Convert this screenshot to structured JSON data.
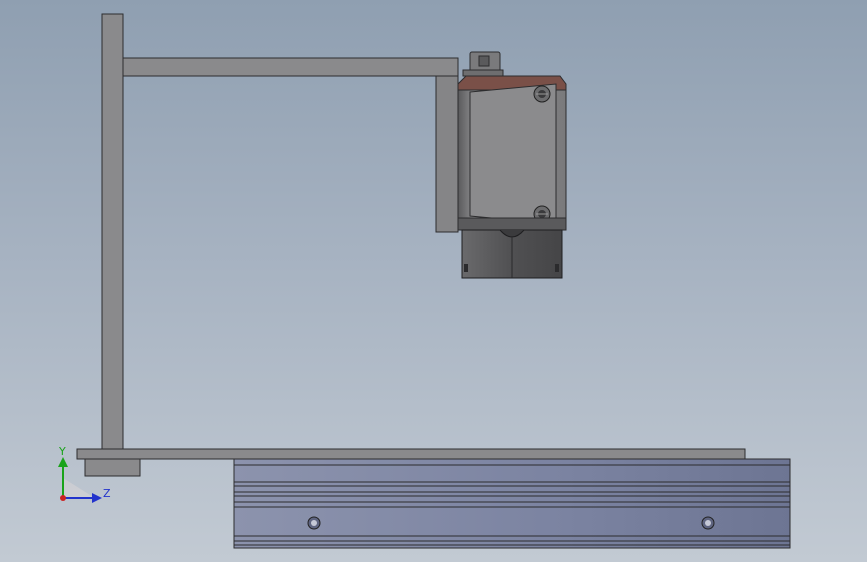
{
  "viewport": {
    "background_top": "#8f9fb1",
    "background_bottom": "#c2cad3"
  },
  "model": {
    "parts": [
      "vertical-post",
      "horizontal-arm",
      "bracket-plate",
      "camera-body",
      "camera-lens",
      "base-plate",
      "mount-foot",
      "rail-block"
    ],
    "colors": {
      "frame": "#8a8a8c",
      "camera_trim": "#7a5048",
      "camera_dark": "#4c4c4e",
      "rail": "#7e86a2"
    }
  },
  "triad": {
    "y_label": "Y",
    "z_label": "Z",
    "y_color": "#1aa31a",
    "z_color": "#2233cc",
    "x_color": "#cc2222"
  }
}
